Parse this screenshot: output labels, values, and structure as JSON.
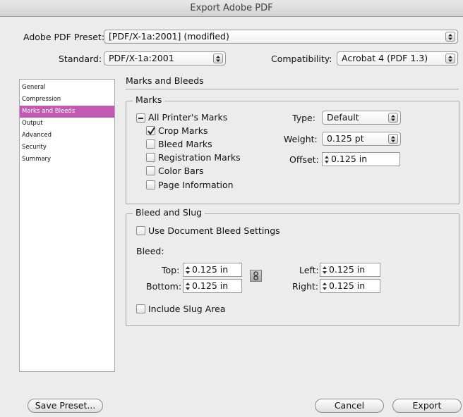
{
  "window": {
    "title": "Export Adobe PDF"
  },
  "header": {
    "preset_label": "Adobe PDF Preset:",
    "preset_value": "[PDF/X-1a:2001] (modified)",
    "standard_label": "Standard:",
    "standard_value": "PDF/X-1a:2001",
    "compatibility_label": "Compatibility:",
    "compatibility_value": "Acrobat 4 (PDF 1.3)"
  },
  "sidebar": {
    "items": [
      "General",
      "Compression",
      "Marks and Bleeds",
      "Output",
      "Advanced",
      "Security",
      "Summary"
    ],
    "selected_index": 2
  },
  "panel": {
    "title": "Marks and Bleeds"
  },
  "marks": {
    "group_title": "Marks",
    "all_printers_marks": "All Printer's Marks",
    "all_printers_marks_state": "mixed",
    "options": [
      {
        "label": "Crop Marks",
        "checked": true
      },
      {
        "label": "Bleed Marks",
        "checked": false
      },
      {
        "label": "Registration Marks",
        "checked": false
      },
      {
        "label": "Color Bars",
        "checked": false
      },
      {
        "label": "Page Information",
        "checked": false
      }
    ],
    "type_label": "Type:",
    "type_value": "Default",
    "weight_label": "Weight:",
    "weight_value": "0.125 pt",
    "offset_label": "Offset:",
    "offset_value": "0.125 in"
  },
  "bleed": {
    "group_title": "Bleed and Slug",
    "use_document_label": "Use Document Bleed Settings",
    "use_document_checked": false,
    "bleed_label": "Bleed:",
    "top_label": "Top:",
    "top_value": "0.125 in",
    "bottom_label": "Bottom:",
    "bottom_value": "0.125 in",
    "left_label": "Left:",
    "left_value": "0.125 in",
    "right_label": "Right:",
    "right_value": "0.125 in",
    "include_slug_label": "Include Slug Area",
    "include_slug_checked": false
  },
  "footer": {
    "save_preset": "Save Preset...",
    "cancel": "Cancel",
    "export": "Export"
  },
  "colors": {
    "selection": "#c35ab1"
  },
  "icons": {
    "popup_arrows": "up-down-arrows-icon",
    "stepper": "stepper-icon",
    "chain": "chain-link-icon",
    "checkmark": "checkmark-icon",
    "mixed": "dash-icon"
  }
}
